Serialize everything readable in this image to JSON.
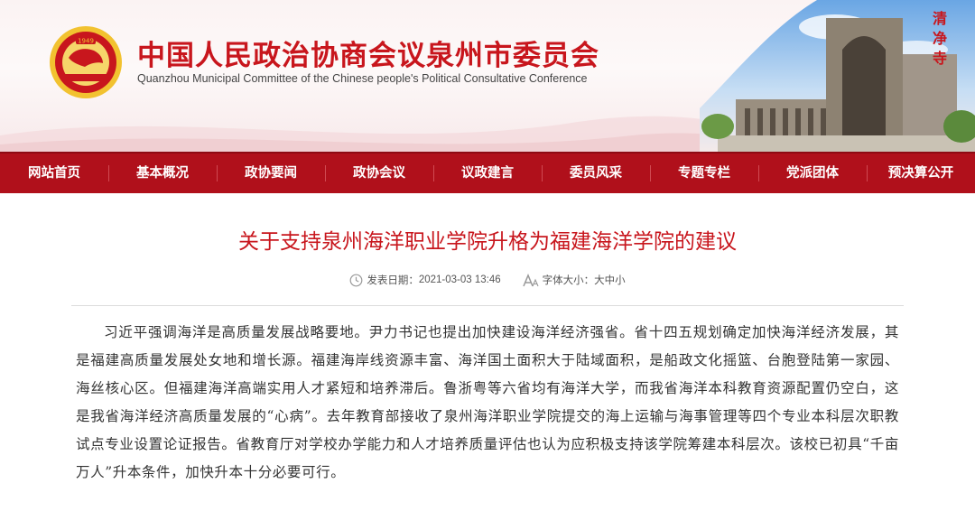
{
  "header": {
    "title": "中国人民政治协商会议泉州市委员会",
    "subtitle": "Quanzhou Municipal Committee of the Chinese people's Political Consultative Conference",
    "emblem_year": "1949",
    "seal_chars": [
      "清",
      "净",
      "寺"
    ]
  },
  "nav": {
    "items": [
      "网站首页",
      "基本概况",
      "政协要闻",
      "政协会议",
      "议政建言",
      "委员风采",
      "专题专栏",
      "党派团体",
      "预决算公开"
    ]
  },
  "article": {
    "title": "关于支持泉州海洋职业学院升格为福建海洋学院的建议",
    "date_label": "发表日期：",
    "date": "2021-03-03 13:46",
    "font_label": "字体大小：",
    "font_options": [
      "大",
      "中",
      "小"
    ],
    "body": "习近平强调海洋是高质量发展战略要地。尹力书记也提出加快建设海洋经济强省。省十四五规划确定加快海洋经济发展，其是福建高质量发展处女地和增长源。福建海岸线资源丰富、海洋国土面积大于陆域面积，是船政文化摇篮、台胞登陆第一家园、海丝核心区。但福建海洋高端实用人才紧短和培养滞后。鲁浙粤等六省均有海洋大学，而我省海洋本科教育资源配置仍空白，这是我省海洋经济高质量发展的“心病”。去年教育部接收了泉州海洋职业学院提交的海上运输与海事管理等四个专业本科层次职教试点专业设置论证报告。省教育厅对学校办学能力和人才培养质量评估也认为应积极支持该学院筹建本科层次。该校已初具“千亩万人”升本条件，加快升本十分必要可行。"
  },
  "colors": {
    "brand_red": "#c8161d",
    "nav_red": "#b0101b",
    "emblem_gold": "#f2c230"
  }
}
